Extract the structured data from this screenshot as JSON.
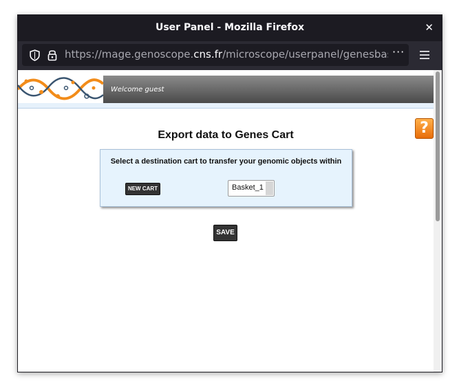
{
  "window": {
    "title": "User Panel - Mozilla Firefox",
    "close_glyph": "✕"
  },
  "navbar": {
    "url_prefix": "https://mage.genoscope.",
    "url_domain": "cns.fr",
    "url_path": "/microscope/userpanel/genesbasketpo",
    "more_glyph": "···",
    "icons": [
      "shield-icon",
      "lock-icon",
      "more-icon",
      "hamburger-menu-icon"
    ]
  },
  "header": {
    "welcome": "Welcome guest"
  },
  "help": {
    "glyph": "?"
  },
  "page": {
    "title": "Export data to Genes Cart"
  },
  "panel": {
    "label": "Select a destination cart to transfer your genomic objects within",
    "new_cart_label": "NEW CART",
    "select_value": "Basket_1"
  },
  "save_label": "SAVE",
  "colors": {
    "titlebar": "#1c1b22",
    "navbar": "#2b2a33",
    "panel_bg": "#e6f3fd",
    "help_orange": "#f28c1a",
    "button_dark": "#333333"
  }
}
